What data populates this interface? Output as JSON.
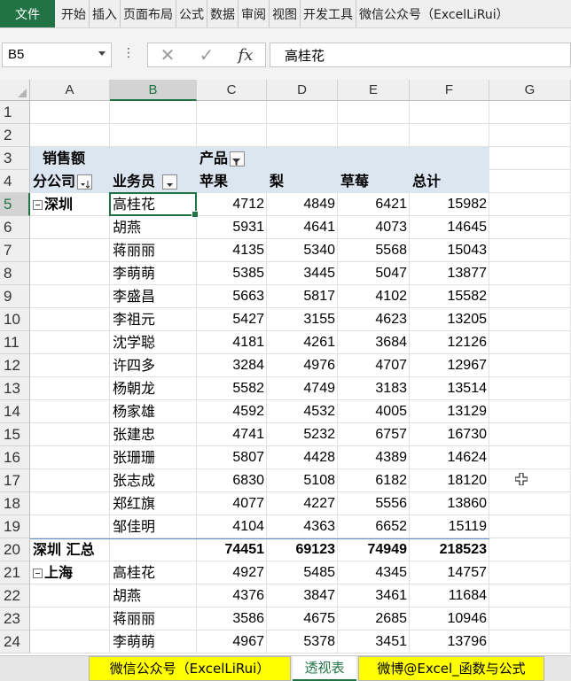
{
  "ribbon": {
    "file": "文件",
    "tabs": [
      "开始",
      "插入",
      "页面布局",
      "公式",
      "数据",
      "审阅",
      "视图",
      "开发工具",
      "微信公众号（ExcelLiRui）"
    ]
  },
  "formula_bar": {
    "name_box": "B5",
    "dots": "⋮",
    "cancel_icon": "✕",
    "enter_icon": "✓",
    "fx": "fx",
    "value": "高桂花"
  },
  "columns": [
    "A",
    "B",
    "C",
    "D",
    "E",
    "F",
    "G"
  ],
  "rows": [
    "1",
    "2",
    "3",
    "4",
    "5",
    "6",
    "7",
    "8",
    "9",
    "10",
    "11",
    "12",
    "13",
    "14",
    "15",
    "16",
    "17",
    "18",
    "19",
    "20",
    "21",
    "22",
    "23",
    "24"
  ],
  "pivot": {
    "values_label": "销售额",
    "column_field": "产品",
    "row_field_1": "分公司",
    "row_field_2": "业务员",
    "col_headers": [
      "苹果",
      "梨",
      "草莓",
      "总计"
    ],
    "group1": "深圳",
    "group1_rows": [
      {
        "name": "高桂花",
        "v": [
          "4712",
          "4849",
          "6421",
          "15982"
        ]
      },
      {
        "name": "胡燕",
        "v": [
          "5931",
          "4641",
          "4073",
          "14645"
        ]
      },
      {
        "name": "蒋丽丽",
        "v": [
          "4135",
          "5340",
          "5568",
          "15043"
        ]
      },
      {
        "name": "李萌萌",
        "v": [
          "5385",
          "3445",
          "5047",
          "13877"
        ]
      },
      {
        "name": "李盛昌",
        "v": [
          "5663",
          "5817",
          "4102",
          "15582"
        ]
      },
      {
        "name": "李祖元",
        "v": [
          "5427",
          "3155",
          "4623",
          "13205"
        ]
      },
      {
        "name": "沈学聪",
        "v": [
          "4181",
          "4261",
          "3684",
          "12126"
        ]
      },
      {
        "name": "许四多",
        "v": [
          "3284",
          "4976",
          "4707",
          "12967"
        ]
      },
      {
        "name": "杨朝龙",
        "v": [
          "5582",
          "4749",
          "3183",
          "13514"
        ]
      },
      {
        "name": "杨家雄",
        "v": [
          "4592",
          "4532",
          "4005",
          "13129"
        ]
      },
      {
        "name": "张建忠",
        "v": [
          "4741",
          "5232",
          "6757",
          "16730"
        ]
      },
      {
        "name": "张珊珊",
        "v": [
          "5807",
          "4428",
          "4389",
          "14624"
        ]
      },
      {
        "name": "张志成",
        "v": [
          "6830",
          "5108",
          "6182",
          "18120"
        ]
      },
      {
        "name": "郑红旗",
        "v": [
          "4077",
          "4227",
          "5556",
          "13860"
        ]
      },
      {
        "name": "邹佳明",
        "v": [
          "4104",
          "4363",
          "6652",
          "15119"
        ]
      }
    ],
    "group1_total_label": "深圳 汇总",
    "group1_total": [
      "74451",
      "69123",
      "74949",
      "218523"
    ],
    "group2": "上海",
    "group2_rows": [
      {
        "name": "高桂花",
        "v": [
          "4927",
          "5485",
          "4345",
          "14757"
        ]
      },
      {
        "name": "胡燕",
        "v": [
          "4376",
          "3847",
          "3461",
          "11684"
        ]
      },
      {
        "name": "蒋丽丽",
        "v": [
          "3586",
          "4675",
          "2685",
          "10946"
        ]
      },
      {
        "name": "李萌萌",
        "v": [
          "4967",
          "5378",
          "3451",
          "13796"
        ]
      }
    ]
  },
  "sheet_tabs": [
    "微信公众号（ExcelLiRui）",
    "透视表",
    "微博@Excel_函数与公式"
  ],
  "active_sheet": "透视表"
}
